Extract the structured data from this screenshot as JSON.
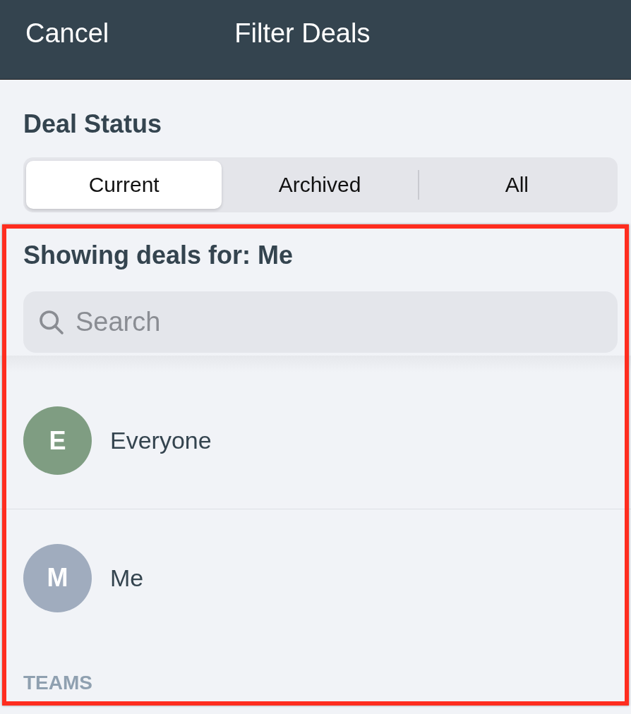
{
  "header": {
    "cancel": "Cancel",
    "title": "Filter Deals"
  },
  "deal_status": {
    "heading": "Deal Status",
    "segments": [
      {
        "label": "Current",
        "selected": true
      },
      {
        "label": "Archived",
        "selected": false
      },
      {
        "label": "All",
        "selected": false
      }
    ]
  },
  "showing": {
    "heading": "Showing deals for: Me",
    "search": {
      "placeholder": "Search"
    },
    "people": [
      {
        "initial": "E",
        "name": "Everyone",
        "color": "#7f9d82"
      },
      {
        "initial": "M",
        "name": "Me",
        "color": "#a0acbe"
      }
    ],
    "section_label": "TEAMS"
  },
  "highlight": {
    "kind": "frame"
  }
}
